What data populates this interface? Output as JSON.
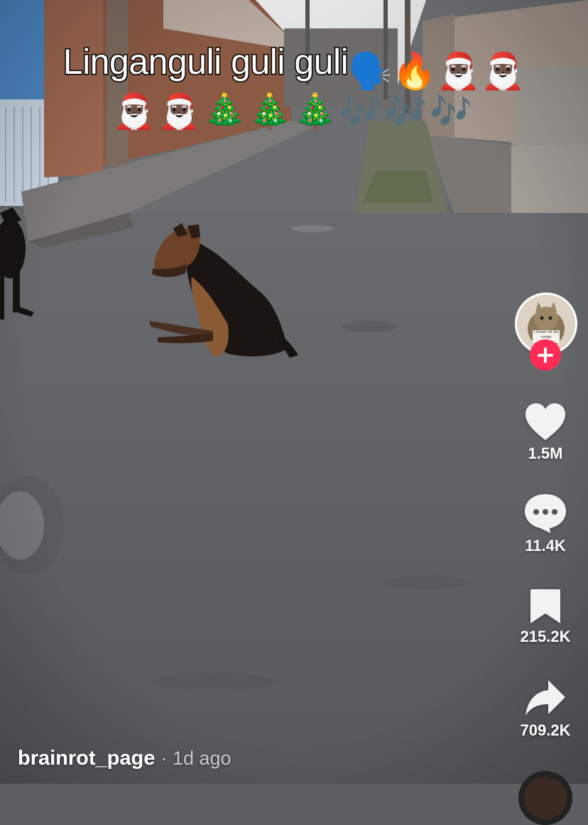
{
  "caption": {
    "text": "Linganguli guli guli",
    "emojis_line1": "🗣️🔥🎅🏿🎅🏿",
    "emojis_line2": "🎅🏿🎅🏿🎄🎄🎄🎶🎶🎶"
  },
  "author": {
    "username": "brainrot_page",
    "separator": "·",
    "time_ago": "1d ago"
  },
  "avatar": {
    "sign_text": "I licked off the cream"
  },
  "actions": {
    "follow": "+",
    "likes": "1.5M",
    "comments": "11.4K",
    "saves": "215.2K",
    "shares": "709.2K"
  },
  "colors": {
    "follow_button": "#fe2c55",
    "icon_fill": "#ffffff"
  },
  "icons": {
    "like": "heart-icon",
    "comment": "comment-bubble-icon",
    "save": "bookmark-icon",
    "share": "share-arrow-icon",
    "follow": "plus-icon"
  }
}
